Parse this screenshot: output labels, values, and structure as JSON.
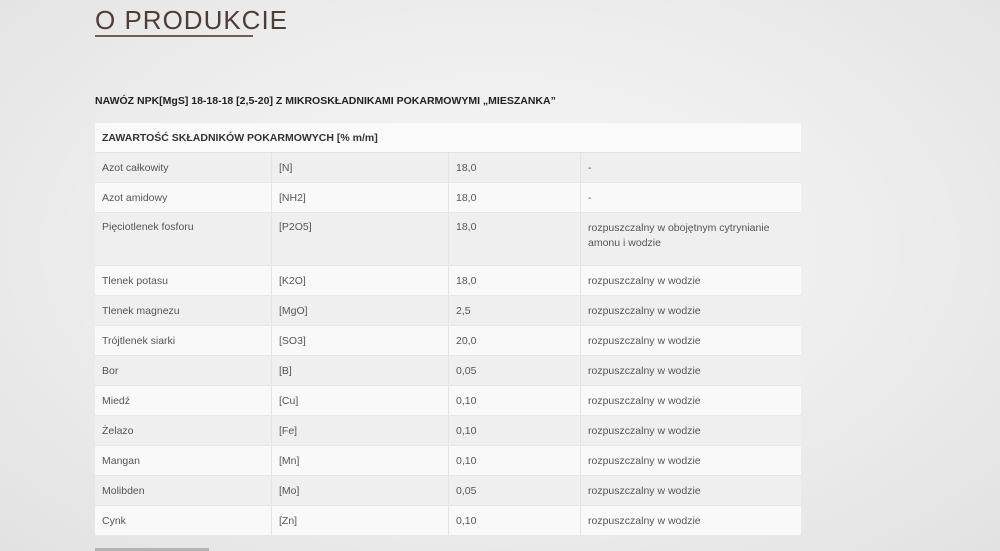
{
  "section": {
    "title": "O PRODUKCIE"
  },
  "product": {
    "name": "NAWÓZ NPK[MgS] 18-18-18 [2,5-20] Z MIKROSKŁADNIKAMI POKARMOWYMI „MIESZANKA”"
  },
  "table": {
    "header": "ZAWARTOŚĆ SKŁADNIKÓW POKARMOWYCH [% m/m]",
    "rows": [
      {
        "name": "Azot całkowity",
        "symbol": "[N]",
        "value": "18,0",
        "note": "-"
      },
      {
        "name": "Azot amidowy",
        "symbol": "[NH2]",
        "value": "18,0",
        "note": "-"
      },
      {
        "name": "Pięciotlenek fosforu",
        "symbol": "[P2O5]",
        "value": "18,0",
        "note": "rozpuszczalny w obojętnym cytrynianie amonu i wodzie"
      },
      {
        "name": "Tlenek potasu",
        "symbol": "[K2O]",
        "value": "18,0",
        "note": "rozpuszczalny w wodzie"
      },
      {
        "name": "Tlenek magnezu",
        "symbol": "[MgO]",
        "value": "2,5",
        "note": "rozpuszczalny w wodzie"
      },
      {
        "name": "Trójtlenek siarki",
        "symbol": "[SO3]",
        "value": "20,0",
        "note": "rozpuszczalny w wodzie"
      },
      {
        "name": "Bor",
        "symbol": "[B]",
        "value": "0,05",
        "note": "rozpuszczalny w wodzie"
      },
      {
        "name": "Miedź",
        "symbol": "[Cu]",
        "value": "0,10",
        "note": "rozpuszczalny w wodzie"
      },
      {
        "name": "Żelazo",
        "symbol": "[Fe]",
        "value": "0,10",
        "note": "rozpuszczalny w wodzie"
      },
      {
        "name": "Mangan",
        "symbol": "[Mn]",
        "value": "0,10",
        "note": "rozpuszczalny w wodzie"
      },
      {
        "name": "Molibden",
        "symbol": "[Mo]",
        "value": "0,05",
        "note": "rozpuszczalny w wodzie"
      },
      {
        "name": "Cynk",
        "symbol": "[Zn]",
        "value": "0,10",
        "note": "rozpuszczalny w wodzie"
      }
    ]
  }
}
